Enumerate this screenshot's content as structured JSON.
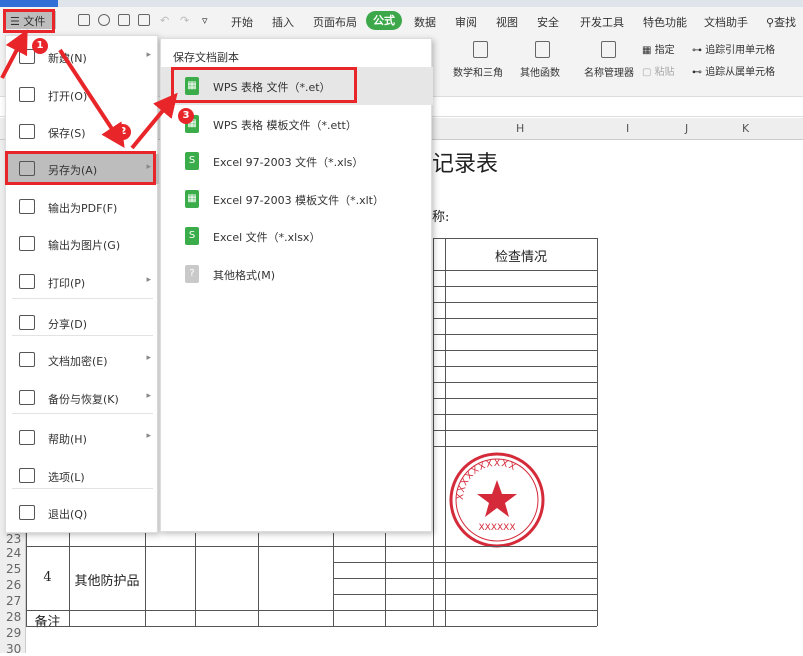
{
  "toolbar": {
    "file": "文件",
    "tabs": [
      "开始",
      "插入",
      "页面布局",
      "公式",
      "数据",
      "审阅",
      "视图",
      "安全",
      "开发工具",
      "特色功能",
      "文档助手"
    ],
    "search": "查找"
  },
  "ribbon": {
    "items": [
      "数学和三角",
      "其他函数",
      "名称管理器",
      "指定",
      "粘贴",
      "追踪引用单元格",
      "追踪从属单元格"
    ]
  },
  "columns": [
    "H",
    "I",
    "J",
    "K"
  ],
  "rows": [
    "23",
    "24",
    "25",
    "26",
    "27",
    "28",
    "29",
    "30"
  ],
  "sheet": {
    "title_fragment": "记录表",
    "subtitle_fragment": "称:",
    "header": "检查情况",
    "row4_no": "4",
    "row4_name": "其他防护品",
    "remark": "备注",
    "stamp_text": "XXXXXXXXXX",
    "stamp_bottom": "XXXXXX"
  },
  "menu": {
    "items": [
      {
        "label": "新建(N)",
        "icon": "new-icon",
        "arrow": true
      },
      {
        "label": "打开(O)",
        "icon": "folder-icon",
        "arrow": false
      },
      {
        "label": "保存(S)",
        "icon": "save-icon",
        "arrow": false
      },
      {
        "label": "另存为(A)",
        "icon": "save-as-icon",
        "arrow": true
      },
      {
        "label": "输出为PDF(F)",
        "icon": "pdf-icon",
        "arrow": false
      },
      {
        "label": "输出为图片(G)",
        "icon": "image-icon",
        "arrow": false
      },
      {
        "label": "打印(P)",
        "icon": "print-icon",
        "arrow": true
      },
      {
        "label": "分享(D)",
        "icon": "share-icon",
        "arrow": false
      },
      {
        "label": "文档加密(E)",
        "icon": "lock-icon",
        "arrow": true
      },
      {
        "label": "备份与恢复(K)",
        "icon": "backup-icon",
        "arrow": true
      },
      {
        "label": "帮助(H)",
        "icon": "help-icon",
        "arrow": true
      },
      {
        "label": "选项(L)",
        "icon": "gear-icon",
        "arrow": false
      },
      {
        "label": "退出(Q)",
        "icon": "exit-icon",
        "arrow": false
      }
    ]
  },
  "submenu": {
    "title": "保存文档副本",
    "items": [
      {
        "label": "WPS 表格 文件（*.et）",
        "glyph": "▦"
      },
      {
        "label": "WPS 表格 模板文件（*.ett）",
        "glyph": "▦"
      },
      {
        "label": "Excel 97-2003 文件（*.xls）",
        "glyph": "S"
      },
      {
        "label": "Excel 97-2003 模板文件（*.xlt）",
        "glyph": "▦"
      },
      {
        "label": "Excel 文件（*.xlsx）",
        "glyph": "S"
      },
      {
        "label": "其他格式(M)",
        "glyph": "?"
      }
    ]
  },
  "badges": [
    "1",
    "2",
    "3"
  ],
  "colors": {
    "accent": "#3ca84a",
    "highlight": "#e8262a",
    "stamp": "#d42a3a"
  }
}
